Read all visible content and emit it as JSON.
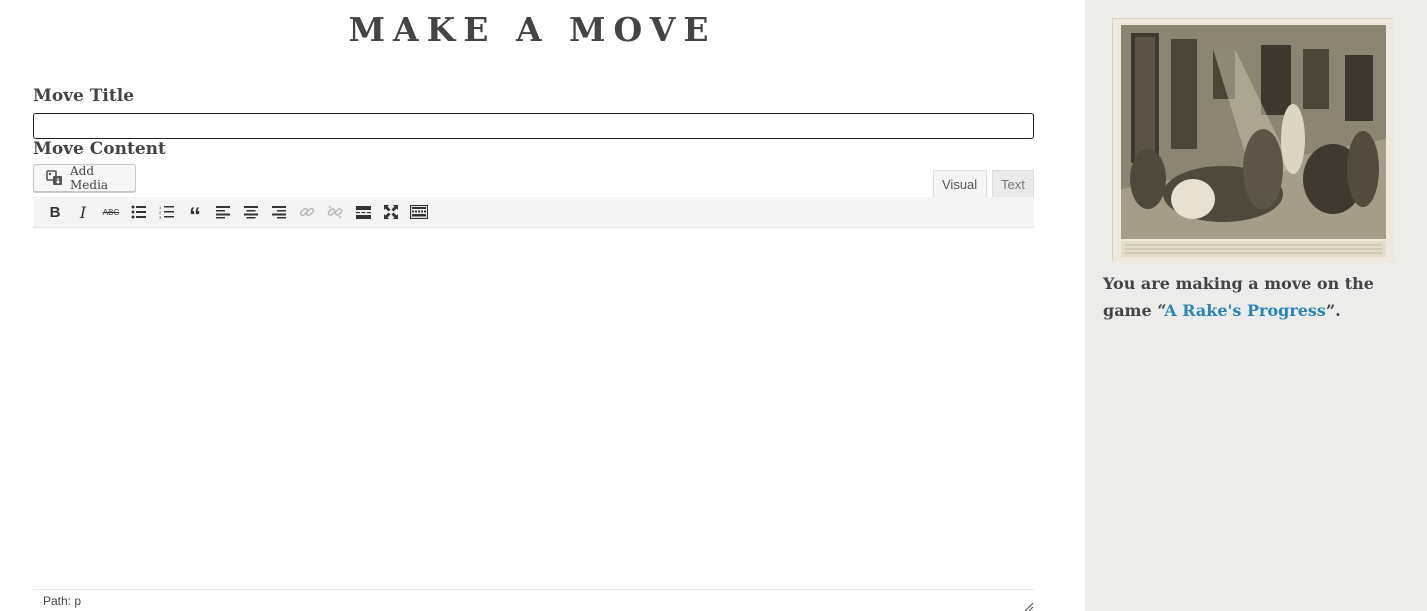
{
  "page": {
    "title": "MAKE A MOVE"
  },
  "form": {
    "title_label": "Move Title",
    "title_value": "",
    "content_label": "Move Content",
    "add_media_label": "Add Media"
  },
  "editor": {
    "tabs": [
      {
        "label": "Visual",
        "active": true
      },
      {
        "label": "Text",
        "active": false
      }
    ],
    "toolbar": [
      {
        "name": "bold",
        "icon": "bold-icon"
      },
      {
        "name": "italic",
        "icon": "italic-icon"
      },
      {
        "name": "strikethrough",
        "icon": "strikethrough-icon"
      },
      {
        "name": "bulleted-list",
        "icon": "bullet-list-icon"
      },
      {
        "name": "numbered-list",
        "icon": "numbered-list-icon"
      },
      {
        "name": "blockquote",
        "icon": "quote-icon"
      },
      {
        "name": "align-left",
        "icon": "align-left-icon"
      },
      {
        "name": "align-center",
        "icon": "align-center-icon"
      },
      {
        "name": "align-right",
        "icon": "align-right-icon"
      },
      {
        "name": "insert-link",
        "icon": "link-icon",
        "disabled": true
      },
      {
        "name": "remove-link",
        "icon": "unlink-icon",
        "disabled": true
      },
      {
        "name": "read-more",
        "icon": "read-more-icon"
      },
      {
        "name": "fullscreen",
        "icon": "fullscreen-icon"
      },
      {
        "name": "toolbar-toggle",
        "icon": "keyboard-icon"
      }
    ],
    "content": "",
    "path_text": "Path: p"
  },
  "sidebar": {
    "text_before": "You are making a move on the game “",
    "game_link": "A Rake's Progress",
    "text_after": "”.",
    "link_color": "#2a85b8",
    "background": "#ecedea"
  }
}
